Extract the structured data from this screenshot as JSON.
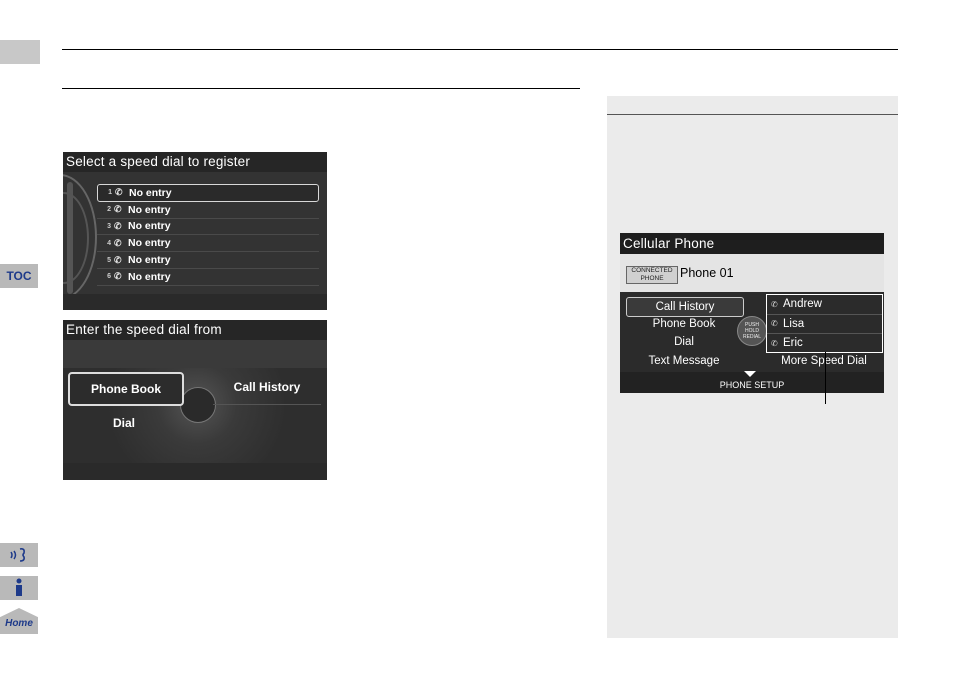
{
  "sidebar": {
    "toc_label": "TOC",
    "voice_icon": "voice-command-icon",
    "info_icon": "info-icon",
    "home_label": "Home"
  },
  "screen1": {
    "title": "Select a speed dial to register",
    "rows": [
      {
        "num": "1",
        "label": "No entry"
      },
      {
        "num": "2",
        "label": "No entry"
      },
      {
        "num": "3",
        "label": "No entry"
      },
      {
        "num": "4",
        "label": "No entry"
      },
      {
        "num": "5",
        "label": "No entry"
      },
      {
        "num": "6",
        "label": "No entry"
      }
    ]
  },
  "screen2": {
    "title": "Enter the speed dial from",
    "phone_book": "Phone Book",
    "call_history": "Call History",
    "dial": "Dial"
  },
  "screen3": {
    "title": "Cellular Phone",
    "connected_badge": "CONNECTED PHONE",
    "phone_name": "Phone 01",
    "menu": [
      "Call History",
      "Phone Book",
      "Dial",
      "Text Message"
    ],
    "redial_label": "PUSH HOLD REDIAL",
    "speed_dials": [
      "Andrew",
      "Lisa",
      "Eric"
    ],
    "more_speed_dial": "More Speed Dial",
    "phone_setup": "PHONE SETUP"
  }
}
